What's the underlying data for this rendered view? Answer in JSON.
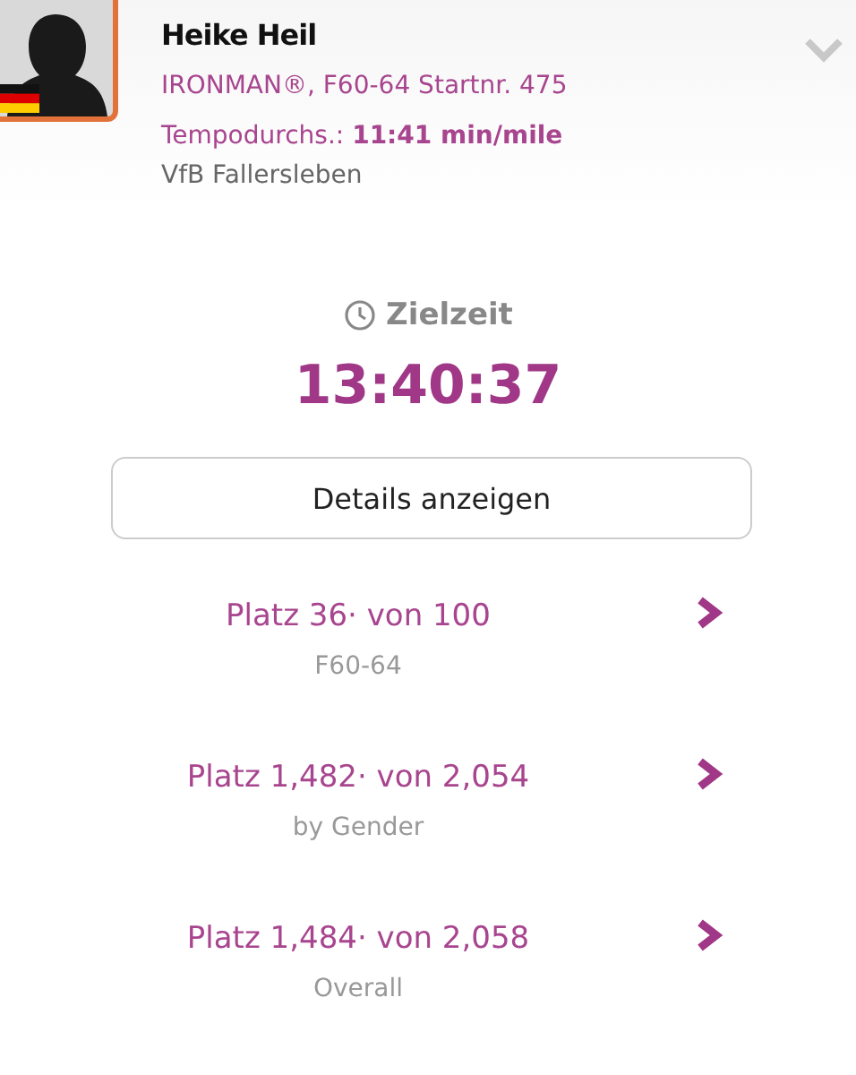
{
  "athlete": {
    "name": "Heike Heil",
    "event": "IRONMAN®, F60-64 Startnr. 475",
    "pace_label": "Tempodurchs.:",
    "pace_value": "11:41 min/mile",
    "club": "VfB Fallersleben",
    "expanded": false
  },
  "finish": {
    "label": "Zielzeit",
    "time": "13:40:37"
  },
  "details_button": "Details anzeigen",
  "rankings": [
    {
      "place": "Platz 36· von 100",
      "category": "F60-64"
    },
    {
      "place": "Platz 1,482· von 2,054",
      "category": "by Gender"
    },
    {
      "place": "Platz 1,484· von 2,058",
      "category": "Overall"
    }
  ]
}
